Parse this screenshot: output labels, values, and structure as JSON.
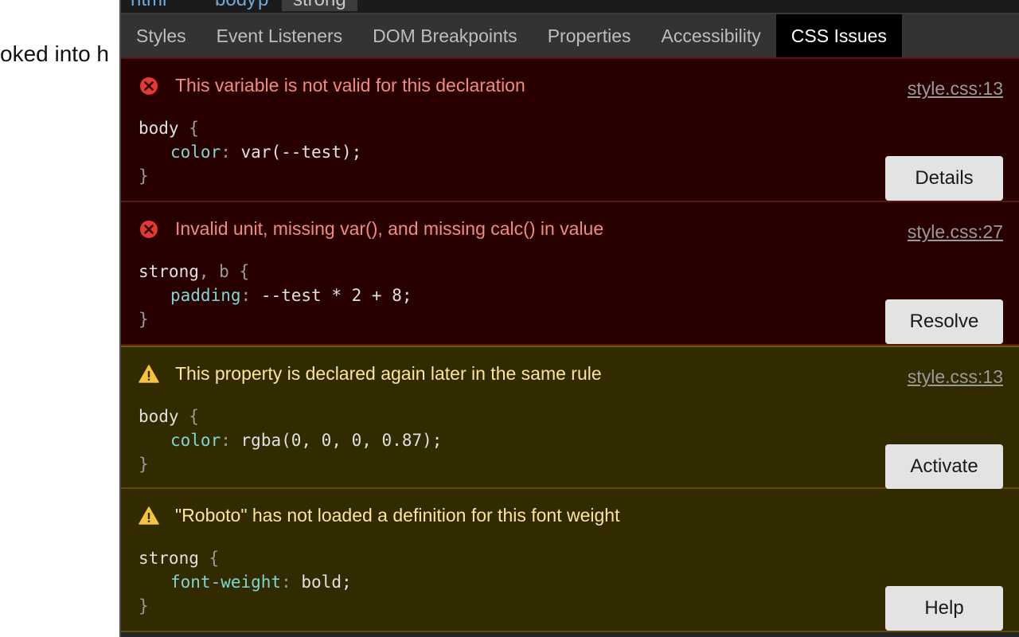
{
  "page": {
    "text": "oked into h"
  },
  "breadcrumbs": [
    "html",
    "body",
    "p",
    "strong"
  ],
  "tabs": [
    {
      "label": "Styles"
    },
    {
      "label": "Event Listeners"
    },
    {
      "label": "DOM Breakpoints"
    },
    {
      "label": "Properties"
    },
    {
      "label": "Accessibility"
    },
    {
      "label": "CSS Issues",
      "active": true
    }
  ],
  "issues": [
    {
      "severity": "error",
      "message": "This variable is not valid for this declaration",
      "location": "style.css:13",
      "selector": "body",
      "selector_extra": "",
      "property": "color",
      "value": "var(--test);",
      "action": "Details"
    },
    {
      "severity": "error",
      "message": "Invalid unit, missing var(), and missing calc() in value",
      "location": "style.css:27",
      "selector": "strong",
      "selector_extra": ", b",
      "property": "padding",
      "value": "--test * 2 + 8;",
      "action": "Resolve"
    },
    {
      "severity": "warning",
      "message": "This property is declared again later in the same rule",
      "location": "style.css:13",
      "selector": "body",
      "selector_extra": "",
      "property": "color",
      "value": "rgba(0, 0, 0, 0.87);",
      "action": "Activate"
    },
    {
      "severity": "warning",
      "message": "\"Roboto\" has not loaded a definition for this font weight",
      "location": "",
      "selector": "strong",
      "selector_extra": "",
      "property": "font-weight",
      "value": "bold;",
      "action": "Help"
    }
  ],
  "code_tokens": {
    "open_brace": "{",
    "close_brace": "}",
    "colon": ":"
  },
  "icons": {
    "error": "error-circle-x-icon",
    "warning": "warning-triangle-icon"
  },
  "colors": {
    "error_bg": "#290000",
    "warning_bg": "#332b00",
    "error_text": "#f28b82",
    "warning_text": "#fde49a",
    "error_icon": "#e53935",
    "warning_icon": "#f5c242"
  }
}
